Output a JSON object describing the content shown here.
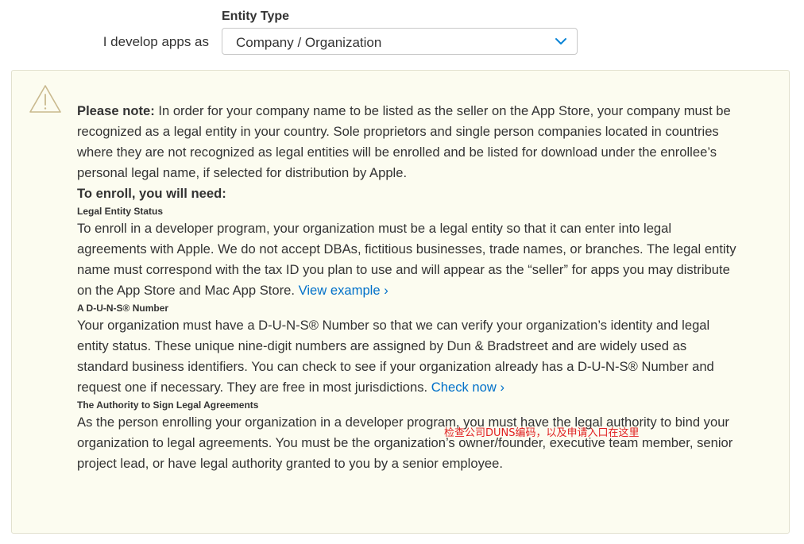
{
  "entity_type": {
    "label": "Entity Type",
    "row_label": "I develop apps as",
    "selected_value": "Company / Organization"
  },
  "note": {
    "intro_bold": "Please note:",
    "intro_text": " In order for your company name to be listed as the seller on the App Store, your company must be recognized as a legal entity in your country. Sole proprietors and single person companies located in countries where they are not recognized as legal entities will be enrolled and be listed for download under the enrollee’s personal legal name, if selected for distribution by Apple.",
    "enroll_heading": "To enroll, you will need:",
    "sections": [
      {
        "heading": "Legal Entity Status",
        "text": "To enroll in a developer program, your organization must be a legal entity so that it can enter into legal agreements with Apple. We do not accept DBAs, fictitious businesses, trade names, or branches. The legal entity name must correspond with the tax ID you plan to use and will appear as the “seller” for apps you may distribute on the App Store and Mac App Store. ",
        "link": "View example ›"
      },
      {
        "heading": "A D-U-N-S® Number",
        "text": "Your organization must have a D-U-N-S® Number so that we can verify your organization’s identity and legal entity status. These unique nine-digit numbers are assigned by Dun & Bradstreet and are widely used as standard business identifiers. You can check to see if your organization already has a D-U-N-S® Number and request one if necessary. They are free in most jurisdictions. ",
        "link": "Check now ›"
      },
      {
        "heading": "The Authority to Sign Legal Agreements",
        "text": "As the person enrolling your organization in a developer program, you must have the legal authority to bind your organization to legal agreements. You must be the organization’s owner/founder, executive team member, senior project lead, or have legal authority granted to you by a senior employee.",
        "link": ""
      }
    ],
    "annotation": "检查公司DUNS编码，以及申请入口在这里"
  },
  "colors": {
    "link": "#0070c9",
    "note_background": "#fcfcf0",
    "annotation": "#e02020",
    "chevron": "#0a84d6"
  },
  "icons": {
    "select_chevron": "chevron-down-icon",
    "warning": "warning-triangle-icon"
  }
}
